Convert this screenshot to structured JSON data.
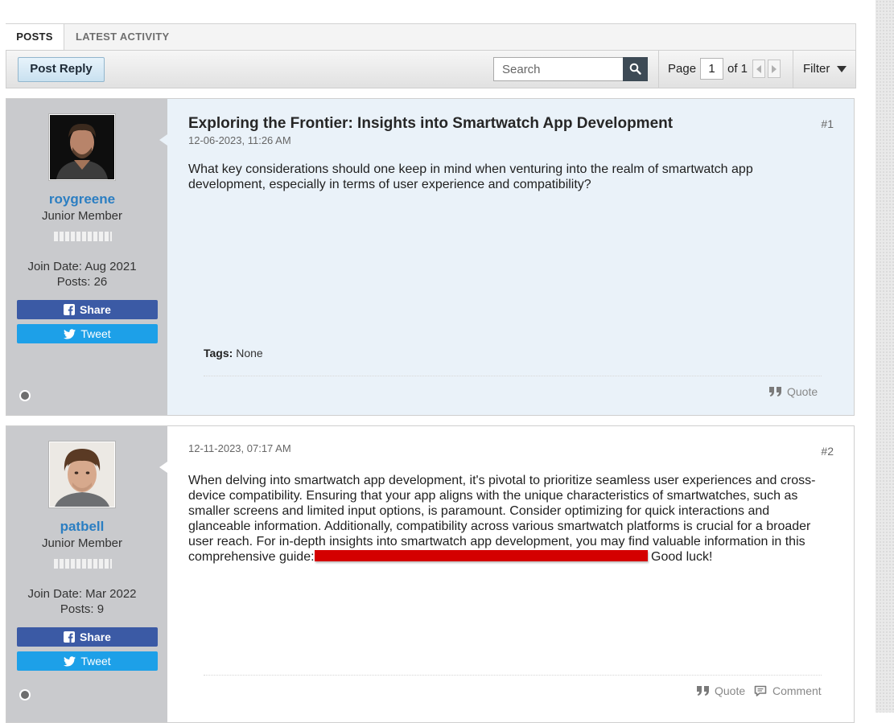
{
  "tabs": {
    "posts": "POSTS",
    "latest": "LATEST ACTIVITY"
  },
  "toolbar": {
    "post_reply": "Post Reply",
    "search_placeholder": "Search",
    "page_label": "Page",
    "page_value": "1",
    "page_of": "of 1",
    "filter": "Filter"
  },
  "posts": [
    {
      "username": "roygreene",
      "rank": "Junior Member",
      "join_date": "Join Date: Aug 2021",
      "post_count": "Posts: 26",
      "share": "Share",
      "tweet": "Tweet",
      "title": "Exploring the Frontier: Insights into Smartwatch App Development",
      "date": "12-06-2023, 11:26 AM",
      "number": "#1",
      "body": "What key considerations should one keep in mind when venturing into the realm of smartwatch app development, especially in terms of user experience and compatibility?",
      "tags_label": "Tags:",
      "tags_value": "None",
      "quote": "Quote"
    },
    {
      "username": "patbell",
      "rank": "Junior Member",
      "join_date": "Join Date: Mar 2022",
      "post_count": "Posts: 9",
      "share": "Share",
      "tweet": "Tweet",
      "date": "12-11-2023, 07:17 AM",
      "number": "#2",
      "body": "When delving into smartwatch app development, it's pivotal to prioritize seamless user experiences and cross-device compatibility. Ensuring that your app aligns with the unique characteristics of smartwatches, such as smaller screens and limited input options, is paramount. Consider optimizing for quick interactions and glanceable information. Additionally, compatibility across various smartwatch platforms is crucial for a broader user reach. For in-depth insights into smartwatch app development, you may find valuable information in this comprehensive guide:",
      "body_after": "Good luck!",
      "quote": "Quote",
      "comment": "Comment"
    }
  ],
  "colors": {
    "username": "#2b7ec2",
    "facebook": "#3b5aa5",
    "twitter": "#1da0e8",
    "redaction": "#d40000",
    "first_post_bg": "#eaf2f9",
    "sidebar_bg": "#c9cacd"
  },
  "icons": {
    "search": "search-icon",
    "prev": "arrow-left-icon",
    "next": "arrow-right-icon",
    "filter": "caret-down-icon",
    "facebook": "facebook-icon",
    "twitter": "twitter-icon",
    "quote": "quote-icon",
    "comment": "comment-icon",
    "online": "online-status-icon"
  }
}
